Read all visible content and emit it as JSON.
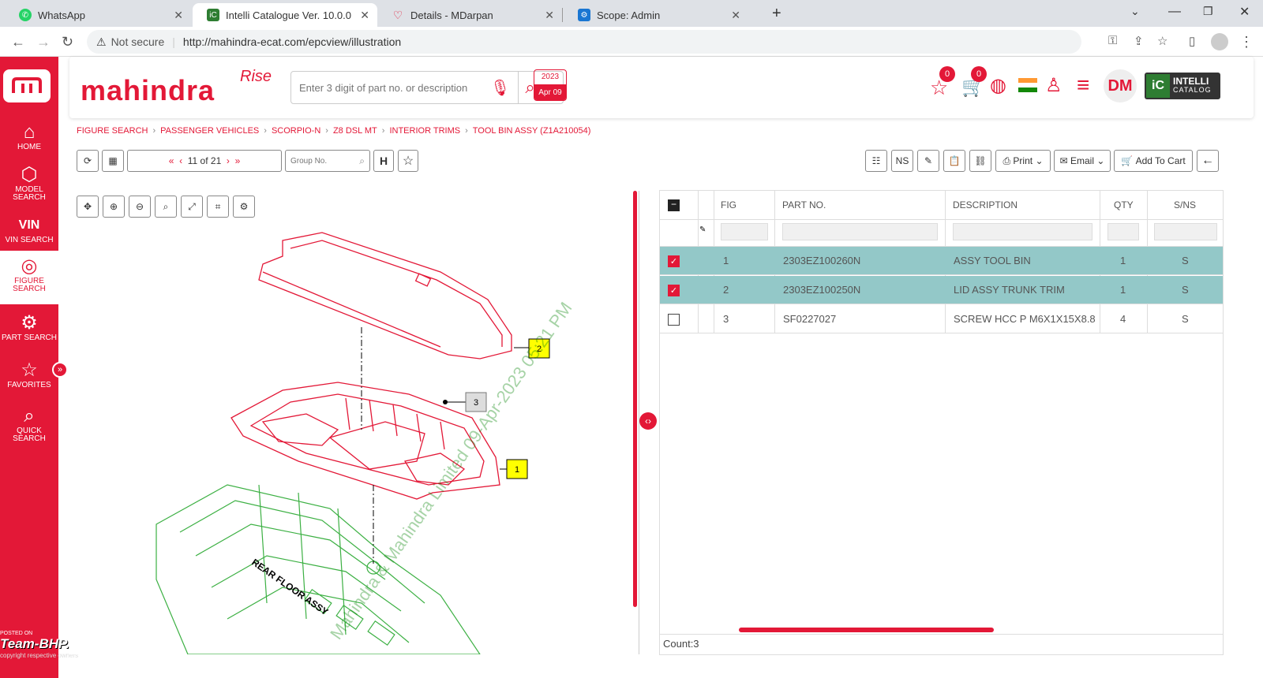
{
  "browser": {
    "tabs": [
      {
        "label": "WhatsApp",
        "color": "#25d366"
      },
      {
        "label": "Intelli Catalogue Ver. 10.0.0",
        "color": "#2e7d32"
      },
      {
        "label": "Details - MDarpan",
        "color": "#e31837"
      },
      {
        "label": "Scope: Admin",
        "color": "#1976d2"
      }
    ],
    "security": "Not secure",
    "url": "http://mahindra-ecat.com/epcview/illustration"
  },
  "sidebar": {
    "items": [
      {
        "label1": "HOME",
        "label2": ""
      },
      {
        "label1": "MODEL",
        "label2": "SEARCH"
      },
      {
        "label1": "VIN SEARCH",
        "label2": ""
      },
      {
        "label1": "FIGURE",
        "label2": "SEARCH"
      },
      {
        "label1": "PART SEARCH",
        "label2": ""
      },
      {
        "label1": "FAVORITES",
        "label2": ""
      },
      {
        "label1": "QUICK",
        "label2": "SEARCH"
      }
    ]
  },
  "header": {
    "logo_text": "mahindra",
    "logo_tag": "Rise",
    "search_placeholder": "Enter 3 digit of part no. or description",
    "date_year": "2023",
    "date_day": "Apr 09",
    "fav_count": "0",
    "cart_count": "0",
    "user_initials": "DM",
    "brand1": "INTELLI",
    "brand2": "CATALOG"
  },
  "breadcrumb": [
    "FIGURE SEARCH",
    "PASSENGER VEHICLES",
    "SCORPIO-N",
    "Z8 DSL MT",
    "INTERIOR TRIMS",
    "TOOL BIN ASSY (Z1A210054)"
  ],
  "toolbar": {
    "page": "11",
    "of": "of 21",
    "group_placeholder": "Group No.",
    "h": "H",
    "ns": "NS",
    "print": "Print",
    "email": "Email",
    "add_to_cart": "Add To Cart"
  },
  "illustration": {
    "callouts": [
      "1",
      "2",
      "3"
    ],
    "floor_label": "REAR FLOOR ASSY",
    "watermark": "Mahindra & Mahindra Limited 09-Apr-2023 05:21 PM"
  },
  "table": {
    "columns": [
      "FIG",
      "PART NO.",
      "DESCRIPTION",
      "QTY",
      "S/NS"
    ],
    "rows": [
      {
        "fig": "1",
        "part": "2303EZ100260N",
        "desc": "ASSY TOOL BIN",
        "qty": "1",
        "sns": "S",
        "checked": true
      },
      {
        "fig": "2",
        "part": "2303EZ100250N",
        "desc": "LID ASSY TRUNK TRIM",
        "qty": "1",
        "sns": "S",
        "checked": true
      },
      {
        "fig": "3",
        "part": "SF0227027",
        "desc": "SCREW HCC P M6X1X15X8.8",
        "qty": "4",
        "sns": "S",
        "checked": false
      }
    ],
    "count": "Count:3"
  },
  "footer_watermark": {
    "line1": "POSTED ON",
    "line2": "Team-BHP.com",
    "line3": "copyright respective owners"
  },
  "colors": {
    "brand_red": "#e31837",
    "selected_row": "#93c8c8",
    "callout_yellow": "#ffff00"
  }
}
